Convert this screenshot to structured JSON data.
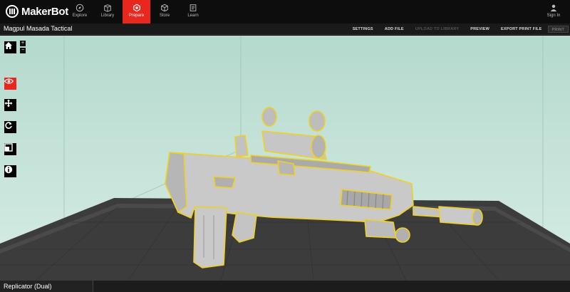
{
  "app": {
    "brand": "MakerBot"
  },
  "nav": {
    "items": [
      {
        "label": "Explore",
        "icon": "compass-icon"
      },
      {
        "label": "Library",
        "icon": "library-icon"
      },
      {
        "label": "Prepare",
        "icon": "prepare-icon",
        "active": true
      },
      {
        "label": "Store",
        "icon": "cube-icon"
      },
      {
        "label": "Learn",
        "icon": "book-icon"
      }
    ],
    "sign_in": "Sign In"
  },
  "project": {
    "title": "Magpul Masada Tactical"
  },
  "actions": {
    "settings": "SETTINGS",
    "add_file": "ADD FILE",
    "upload": "UPLOAD TO LIBRARY",
    "preview": "PREVIEW",
    "export": "EXPORT PRINT FILE",
    "print": "PRINT"
  },
  "tools": [
    "home-icon",
    "look-icon",
    "move-icon",
    "rotate-icon",
    "scale-icon",
    "info-icon"
  ],
  "zoom": {
    "in": "+",
    "out": "−"
  },
  "status": {
    "printer": "Replicator (Dual)"
  },
  "colors": {
    "accent": "#e8281e",
    "topbar": "#0d0d0d",
    "viewport": "#c4e2d8",
    "plate": "#3a3a3a",
    "model": "#c9c9c9",
    "outline": "#f0d020"
  }
}
